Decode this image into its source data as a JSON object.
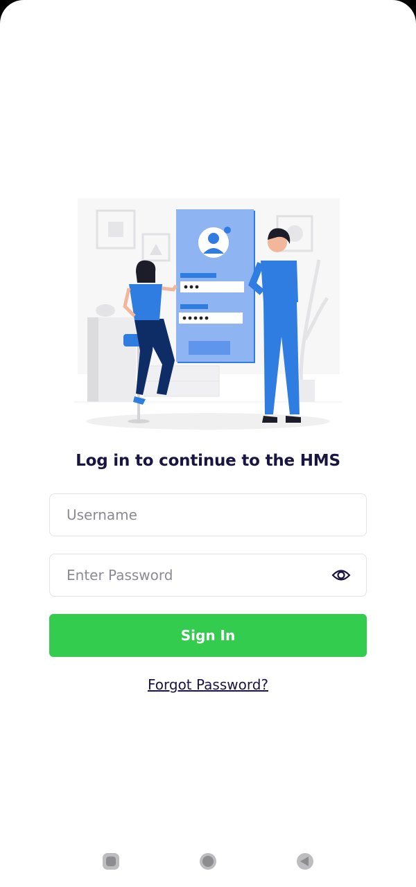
{
  "login": {
    "title": "Log in to continue to the HMS",
    "username_placeholder": "Username",
    "password_placeholder": "Enter Password",
    "sign_in_label": "Sign In",
    "forgot_label": "Forgot Password?"
  },
  "colors": {
    "accent_green": "#33cc4f",
    "title_dark": "#1a1442",
    "illustration_blue": "#2f7de1"
  },
  "icons": {
    "password_toggle": "eye-icon",
    "nav_recents": "square-icon",
    "nav_home": "circle-icon",
    "nav_back": "triangle-back-icon"
  }
}
